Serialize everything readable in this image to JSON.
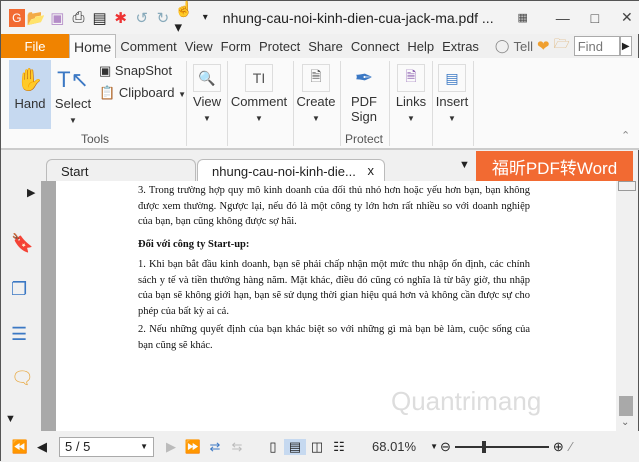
{
  "title_bar": {
    "title": "nhung-cau-noi-kinh-dien-cua-jack-ma.pdf ..."
  },
  "menu": {
    "file": "File",
    "tabs": [
      "Home",
      "Comment",
      "View",
      "Form",
      "Protect",
      "Share",
      "Connect",
      "Help",
      "Extras"
    ],
    "tell": "Tell",
    "find_placeholder": "Find"
  },
  "ribbon": {
    "hand": "Hand",
    "select": "Select",
    "snapshot": "SnapShot",
    "clipboard": "Clipboard",
    "tools_group": "Tools",
    "view": "View",
    "comment": "Comment",
    "create": "Create",
    "pdf_sign_1": "PDF",
    "pdf_sign_2": "Sign",
    "protect_group": "Protect",
    "links": "Links",
    "insert": "Insert"
  },
  "doc_tabs": {
    "start": "Start",
    "active": "nhung-cau-noi-kinh-die...",
    "close": "x"
  },
  "promo": "福昕PDF转Word",
  "document": {
    "paragraphs": [
      "3. Trong trường hợp quy mô kinh doanh của đối thủ nhỏ hơn hoặc yếu hơn bạn, bạn không được xem thường. Ngược lại, nếu đó là một công ty lớn hơn rất nhiều so với doanh nghiệp của bạn, bạn cũng không được sợ hãi.",
      "Đối với công ty Start-up:",
      "1. Khi bạn bắt đầu kinh doanh, bạn sẽ phải chấp nhận một mức thu nhập ổn định, các chính sách y tế và tiền thưởng hàng năm. Mặt khác, điều đó cũng có nghĩa là từ bây giờ, thu nhập của bạn sẽ không giới hạn, bạn sẽ sử dụng thời gian hiệu quả hơn và không cần được sự cho phép của bất kỳ ai cả.",
      "2. Nếu những quyết định của bạn khác biệt so với những gì mà bạn bè làm, cuộc sống của bạn cũng sẽ khác."
    ],
    "watermark": "Quantrimang"
  },
  "status": {
    "page": "5 / 5",
    "zoom": "68.01%",
    "zoom_fraction": 0.3
  }
}
